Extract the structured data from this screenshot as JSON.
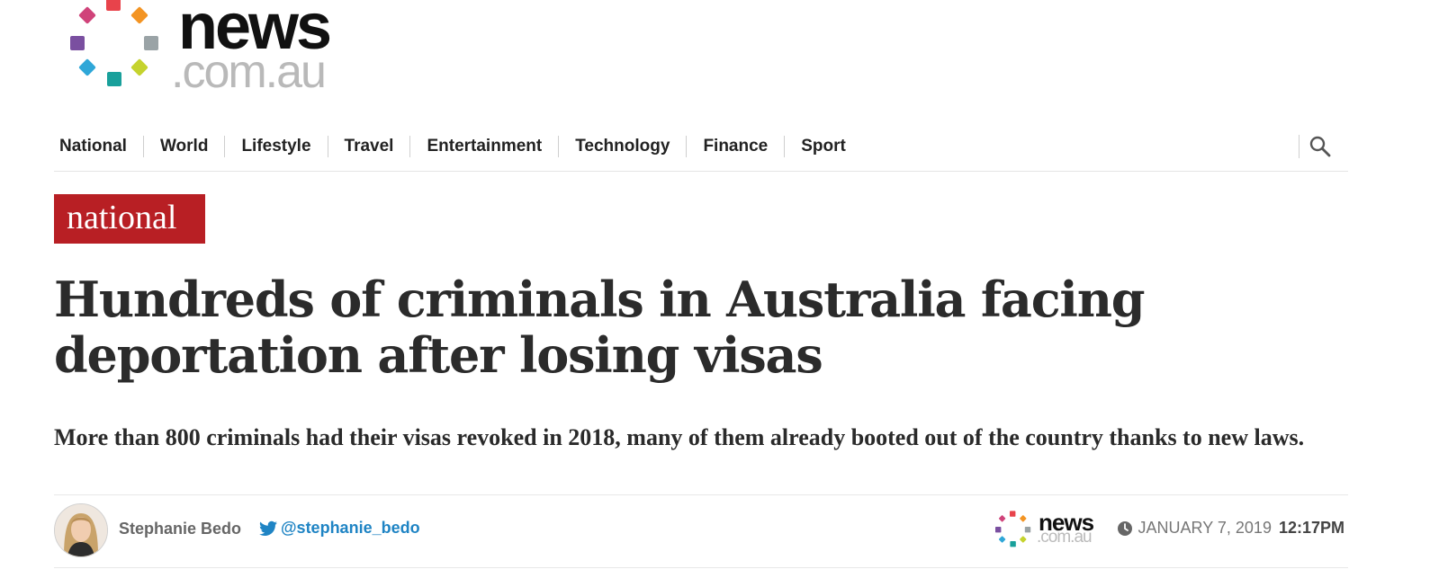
{
  "brand": {
    "logo_word": "news",
    "logo_domain": ".com.au",
    "small_logo_word": "news",
    "small_logo_domain": ".com.au",
    "dot_colors": [
      "#d0437a",
      "#e8434b",
      "#f39423",
      "#9aa3a6",
      "#c5d32e",
      "#19a09b",
      "#2fa7d8",
      "#7a4fa0"
    ]
  },
  "nav": {
    "items": [
      "National",
      "World",
      "Lifestyle",
      "Travel",
      "Entertainment",
      "Technology",
      "Finance",
      "Sport"
    ],
    "search_icon": "search-icon"
  },
  "article": {
    "section_tag": "national",
    "section_color": "#b81f24",
    "headline": "Hundreds of criminals in Australia facing deportation after losing visas",
    "standfirst": "More than 800 criminals had their visas revoked in 2018, many of them already booted out of the country thanks to new laws.",
    "author": "Stephanie Bedo",
    "twitter_handle": "@stephanie_bedo",
    "twitter_color": "#1f84c4",
    "date": "JANUARY 7, 2019",
    "time": "12:17PM"
  }
}
